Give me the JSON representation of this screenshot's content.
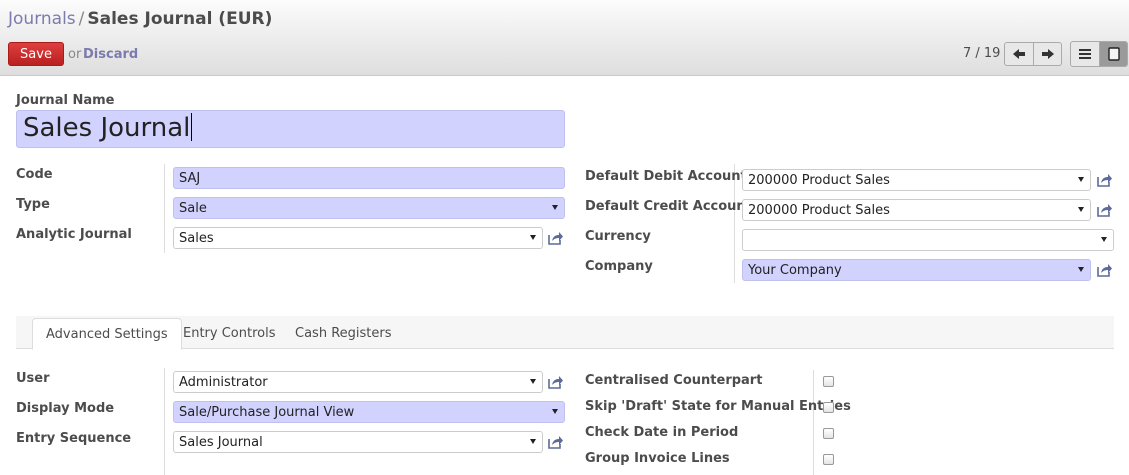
{
  "breadcrumb": {
    "parent": "Journals",
    "separator": "/",
    "current": "Sales Journal (EUR)"
  },
  "toolbar": {
    "save_label": "Save",
    "or_text": "or",
    "discard_label": "Discard",
    "pager": "7 / 19"
  },
  "colors": {
    "required_field": "#d2d2ff",
    "save_button": "#c72a2a",
    "link": "#7c7bad"
  },
  "form": {
    "journal_name_label": "Journal Name",
    "journal_name_value": "Sales Journal",
    "left": {
      "code_label": "Code",
      "code_value": "SAJ",
      "type_label": "Type",
      "type_value": "Sale",
      "analytic_label": "Analytic Journal",
      "analytic_value": "Sales"
    },
    "right": {
      "debit_label": "Default Debit Account",
      "debit_value": "200000 Product Sales",
      "credit_label": "Default Credit Account",
      "credit_value": "200000 Product Sales",
      "currency_label": "Currency",
      "currency_value": "",
      "company_label": "Company",
      "company_value": "Your Company"
    }
  },
  "tabs": [
    {
      "label": "Advanced Settings",
      "active": true
    },
    {
      "label": "Entry Controls",
      "active": false
    },
    {
      "label": "Cash Registers",
      "active": false
    }
  ],
  "advanced": {
    "user_label": "User",
    "user_value": "Administrator",
    "display_mode_label": "Display Mode",
    "display_mode_value": "Sale/Purchase Journal View",
    "entry_sequence_label": "Entry Sequence",
    "entry_sequence_value": "Sales Journal",
    "checks": [
      {
        "label": "Centralised Counterpart",
        "checked": false
      },
      {
        "label": "Skip 'Draft' State for Manual Entries",
        "checked": false
      },
      {
        "label": "Check Date in Period",
        "checked": false
      },
      {
        "label": "Group Invoice Lines",
        "checked": false
      }
    ]
  },
  "icons": {
    "pager_prev": "arrow-left-icon",
    "pager_next": "arrow-right-icon",
    "list_view": "list-icon",
    "form_view": "form-view-icon",
    "external_link": "external-link-icon",
    "select_caret": "caret-down-icon"
  }
}
